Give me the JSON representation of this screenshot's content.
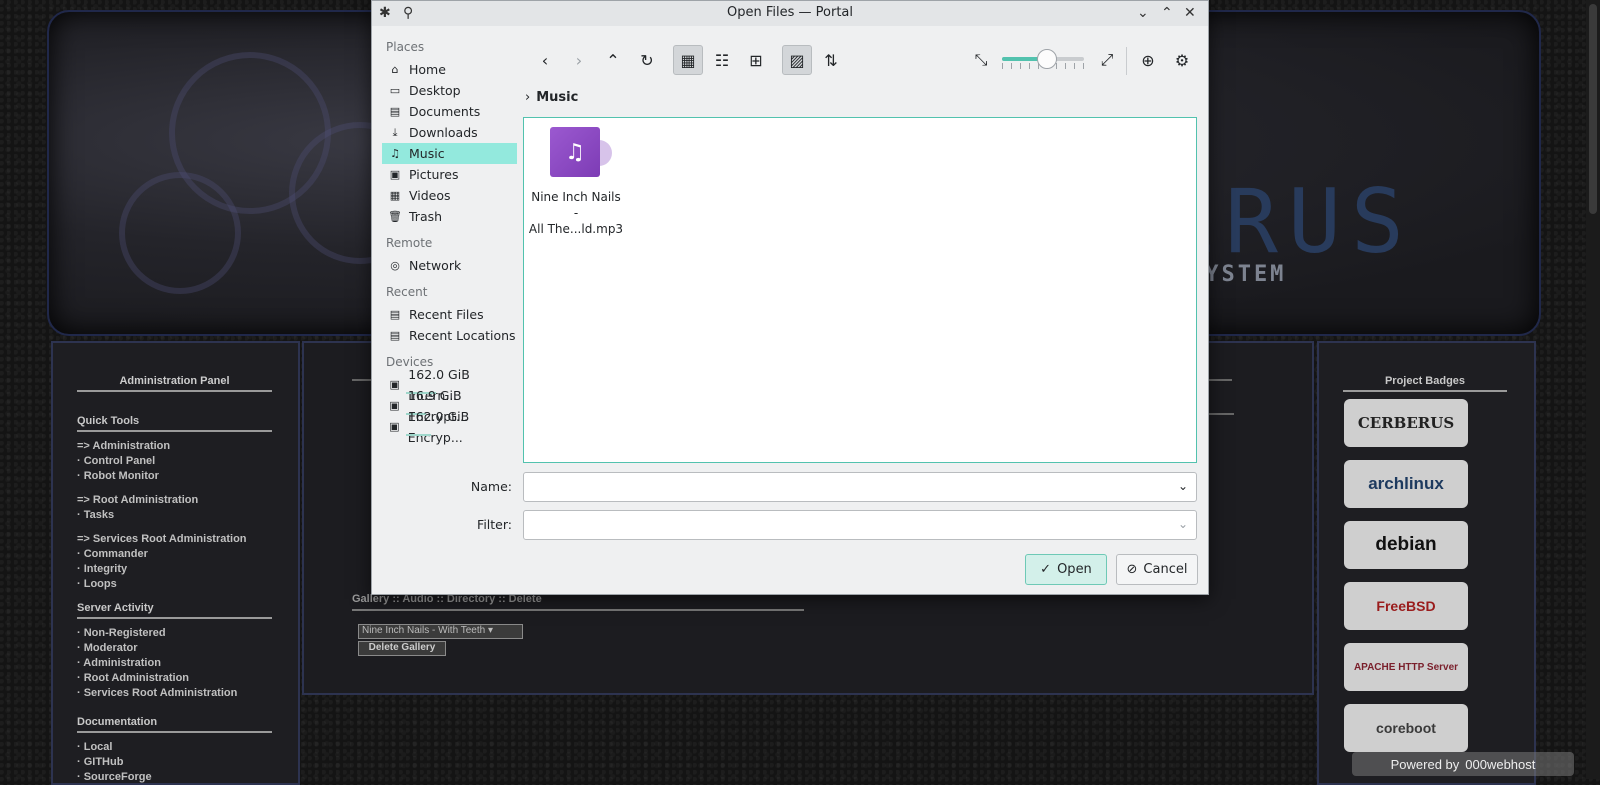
{
  "background_page": {
    "banner_title_fragment": "BERUS",
    "banner_subtitle_fragment": "AGEMENT SYSTEM",
    "left_panel": {
      "title": "Administration Panel",
      "sections": [
        {
          "heading": "Quick Tools",
          "links": [
            "=> Administration",
            "· Control Panel",
            "· Robot Monitor",
            "",
            "=> Root Administration",
            "· Tasks",
            "",
            "=> Services Root Administration",
            "· Commander",
            "· Integrity",
            "· Loops"
          ]
        },
        {
          "heading": "Server Activity",
          "links": [
            "· Non-Registered",
            "· Moderator",
            "· Administration",
            "· Root Administration",
            "· Services Root Administration"
          ]
        },
        {
          "heading": "Documentation",
          "links": [
            "· Local",
            "· GITHub",
            "· SourceForge"
          ]
        }
      ]
    },
    "middle_panel": {
      "gallery_heading": "Gallery :: Audio :: Directory :: Delete",
      "gallery_select_value": "Nine Inch Nails - With Teeth",
      "delete_button": "Delete Gallery"
    },
    "right_panel": {
      "title": "Project Badges",
      "badges": [
        "CERBERUS",
        "archlinux",
        "debian",
        "FreeBSD",
        "APACHE HTTP Server",
        "coreboot"
      ]
    },
    "powered_by": {
      "label": "Powered by",
      "host": "000webhost"
    }
  },
  "dialog": {
    "title": "Open Files — Portal",
    "places": {
      "groups": [
        {
          "heading": "Places",
          "items": [
            {
              "label": "Home",
              "icon": "home-icon",
              "glyph": "⌂"
            },
            {
              "label": "Desktop",
              "icon": "desktop-icon",
              "glyph": "▭"
            },
            {
              "label": "Documents",
              "icon": "documents-icon",
              "glyph": "▤"
            },
            {
              "label": "Downloads",
              "icon": "download-icon",
              "glyph": "⤓"
            },
            {
              "label": "Music",
              "icon": "music-icon",
              "glyph": "♫",
              "selected": true
            },
            {
              "label": "Pictures",
              "icon": "pictures-icon",
              "glyph": "▣"
            },
            {
              "label": "Videos",
              "icon": "videos-icon",
              "glyph": "▦"
            },
            {
              "label": "Trash",
              "icon": "trash-icon",
              "glyph": "🗑"
            }
          ]
        },
        {
          "heading": "Remote",
          "items": [
            {
              "label": "Network",
              "icon": "network-icon",
              "glyph": "◎"
            }
          ]
        },
        {
          "heading": "Recent",
          "items": [
            {
              "label": "Recent Files",
              "icon": "recent-files-icon",
              "glyph": "▤"
            },
            {
              "label": "Recent Locations",
              "icon": "recent-locations-icon",
              "glyph": "▤"
            }
          ]
        },
        {
          "heading": "Devices",
          "items": [
            {
              "label": "162.0 GiB Intern...",
              "icon": "drive-icon",
              "glyph": "▣",
              "usage": 0.3
            },
            {
              "label": "16.9 GiB Encrypt...",
              "icon": "encrypted-drive-icon",
              "glyph": "▣",
              "usage": 0.2
            },
            {
              "label": "162.0 GiB Encryp...",
              "icon": "encrypted-drive-icon",
              "glyph": "▣",
              "usage": 0.25
            }
          ]
        }
      ]
    },
    "breadcrumb": "Music",
    "files": [
      {
        "name": "Nine Inch Nails - All The...ld.mp3",
        "name_line1": "Nine Inch Nails -",
        "name_line2": "All The...ld.mp3",
        "icon": "audio-file-icon"
      }
    ],
    "zoom_level": 0.55,
    "name_label": "Name:",
    "name_value": "",
    "filter_label": "Filter:",
    "filter_value": "",
    "open_button": "Open",
    "cancel_button": "Cancel"
  }
}
